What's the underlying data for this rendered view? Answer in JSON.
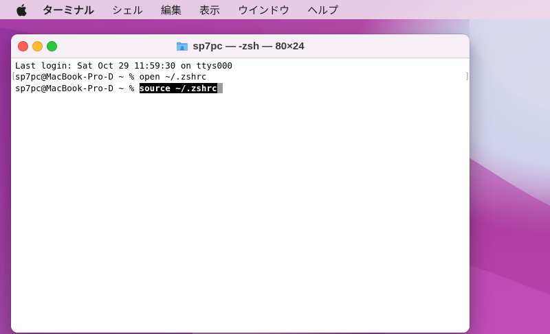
{
  "menubar": {
    "apple_icon": "apple-logo-icon",
    "app_name": "ターミナル",
    "items": [
      "シェル",
      "編集",
      "表示",
      "ウインドウ",
      "ヘルプ"
    ]
  },
  "window": {
    "title": "sp7pc — -zsh — 80×24",
    "title_icon": "folder-icon",
    "traffic_lights": {
      "close_color": "#fe5f57",
      "minimize_color": "#febc2e",
      "zoom_color": "#28c840"
    }
  },
  "terminal": {
    "last_login": "Last login: Sat Oct 29 11:59:30 on ttys000",
    "prompt": "sp7pc@MacBook-Pro-D ~ % ",
    "command1": "open ~/.zshrc",
    "command2_selected": "source ~/.zshrc",
    "mark_left": "[",
    "mark_right": "]"
  }
}
